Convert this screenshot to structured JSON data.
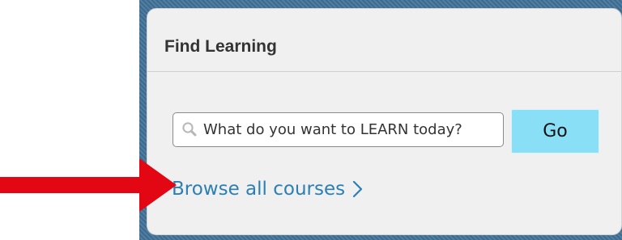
{
  "colors": {
    "panel_background": "#f0f0f0",
    "frame_pattern": "#456f92",
    "title_text": "#333333",
    "input_border": "#8a8a8a",
    "go_button": "#89dff6",
    "link_text": "#2b7fb2",
    "annotation_arrow": "#e30613"
  },
  "panel": {
    "title": "Find Learning",
    "search": {
      "placeholder": "What do you want to LEARN today?",
      "icon": "search-icon"
    },
    "go_button": {
      "label": "Go"
    },
    "browse_link": {
      "label": "Browse all courses",
      "icon": "chevron-right-icon"
    }
  },
  "annotation": {
    "icon": "right-arrow-icon",
    "target": "browse-all-courses-link"
  }
}
